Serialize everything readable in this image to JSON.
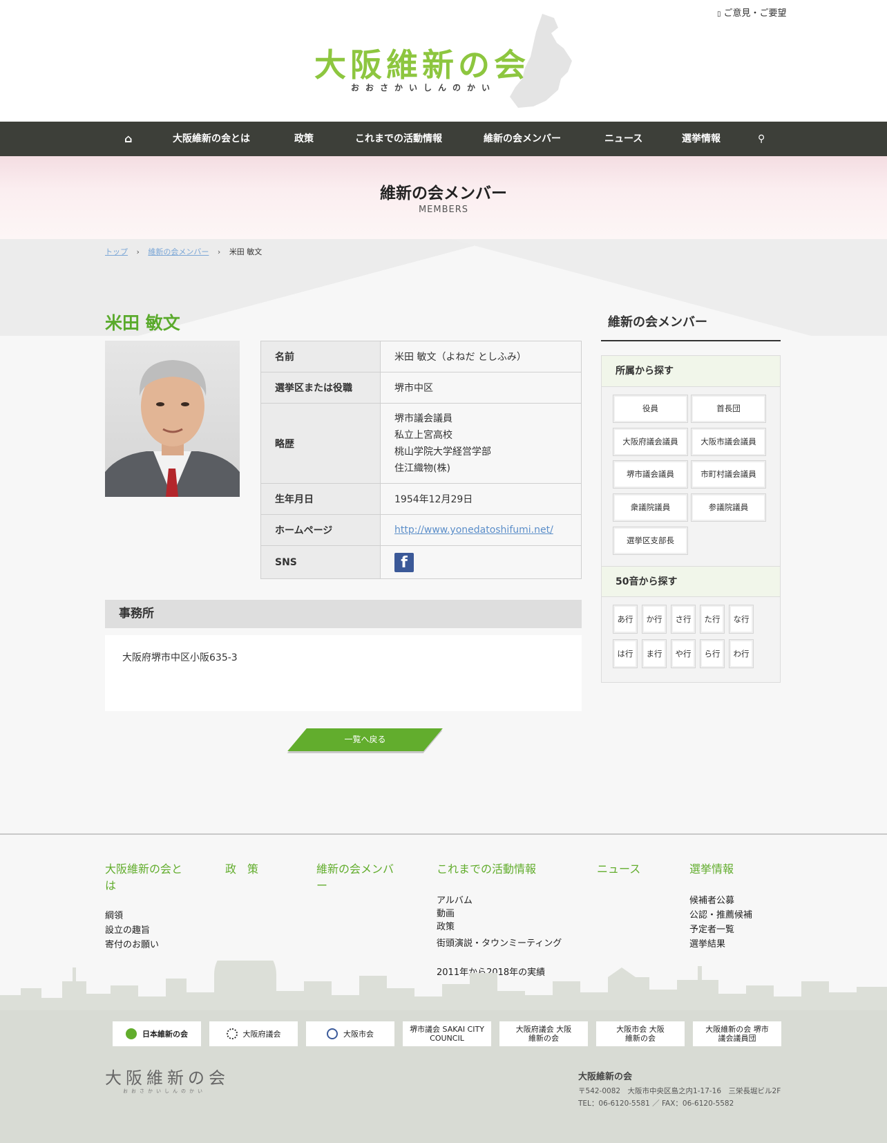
{
  "header": {
    "opinion_label": "ご意見・ご要望",
    "logo_title": "大阪維新の会",
    "logo_kana": "おおさかいしんのかい"
  },
  "nav": {
    "home_icon": "home-icon",
    "items": [
      "大阪維新の会とは",
      "政策",
      "これまでの活動情報",
      "維新の会メンバー",
      "ニュース",
      "選挙情報"
    ],
    "search_icon": "search-icon"
  },
  "hero": {
    "title": "維新の会メンバー",
    "subtitle": "MEMBERS"
  },
  "breadcrumb": {
    "top": "トップ",
    "members": "維新の会メンバー",
    "current": "米田 敏文"
  },
  "member": {
    "name": "米田 敏文",
    "table": {
      "name_label": "名前",
      "name_value": "米田 敏文（よねだ としふみ）",
      "area_label": "選挙区または役職",
      "area_value": "堺市中区",
      "history_label": "略歴",
      "history": [
        "堺市議会議員",
        "私立上宮高校",
        "桃山学院大学経営学部",
        "住江織物(株)"
      ],
      "birth_label": "生年月日",
      "birth_value": "1954年12月29日",
      "home_label": "ホームページ",
      "home_value": "http://www.yonedatoshifumi.net/",
      "sns_label": "SNS"
    },
    "office_title": "事務所",
    "office_address": "大阪府堺市中区小阪635-3",
    "back_label": "一覧へ戻る"
  },
  "sidebar": {
    "title": "維新の会メンバー",
    "affiliation_title": "所属から探す",
    "affiliations": [
      "役員",
      "首長団",
      "大阪府議会議員",
      "大阪市議会議員",
      "堺市議会議員",
      "市町村議会議員",
      "衆議院議員",
      "参議院議員",
      "選挙区支部長"
    ],
    "kana_title": "50音から探す",
    "kana": [
      "あ行",
      "か行",
      "さ行",
      "た行",
      "な行",
      "は行",
      "ま行",
      "や行",
      "ら行",
      "わ行"
    ]
  },
  "footer": {
    "col1_title": "大阪維新の会とは",
    "col1_links": [
      "綱領",
      "設立の趣旨",
      "寄付のお願い"
    ],
    "col2_title": "政　策",
    "col3_title": "維新の会メンバー",
    "col4_title": "これまでの活動情報",
    "col4_links": [
      "アルバム",
      "動画",
      "政策",
      "街頭演説・タウンミーティング",
      "2011年から2018年の実績"
    ],
    "col5_title": "ニュース",
    "col6_title": "選挙情報",
    "col6_links": [
      "候補者公募",
      "公認・推薦候補",
      "予定者一覧",
      "選挙結果"
    ],
    "banners": [
      "日本維新の会",
      "大阪府議会",
      "大阪市会",
      "堺市議会 SAKAI CITY COUNCIL",
      "大阪府議会 大阪維新の会",
      "大阪市会 大阪維新の会",
      "大阪維新の会 堺市議会議員団"
    ],
    "logo": "大阪維新の会",
    "logo_kana": "おおさかいしんのかい",
    "org": "大阪維新の会",
    "address": "〒542-0082　大阪市中央区島之内1-17-16　三栄長堀ビル2F",
    "tel": "TEL：06-6120-5581 ／ FAX：06-6120-5582"
  },
  "colors": {
    "accent_green": "#62ad2d",
    "nav_bg": "#3d3f39",
    "logo_green": "#8dc63f"
  }
}
